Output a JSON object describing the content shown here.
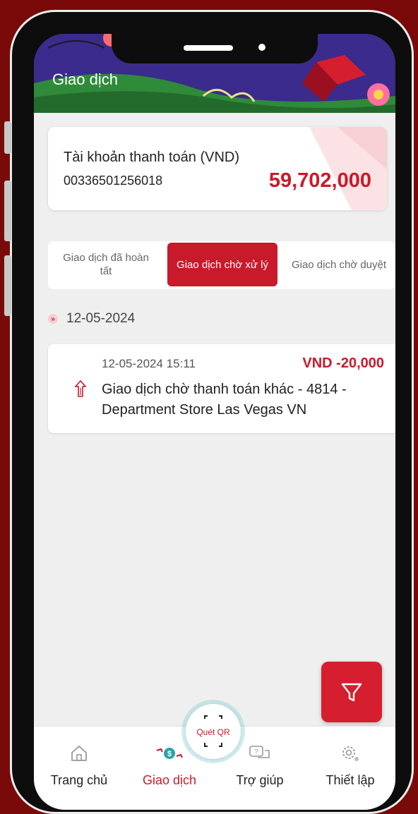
{
  "header": {
    "title": "Giao dịch"
  },
  "account": {
    "label": "Tài khoản thanh toán (VND)",
    "number": "00336501256018",
    "balance": "59,702,000"
  },
  "tabs": [
    {
      "label": "Giao dịch đã hoàn tất",
      "active": false
    },
    {
      "label": "Giao dịch chờ xử lý",
      "active": true
    },
    {
      "label": "Giao dịch chờ duyệt",
      "active": false
    }
  ],
  "date_group": {
    "date": "12-05-2024"
  },
  "transaction": {
    "time": "12-05-2024 15:11",
    "amount": "VND -20,000",
    "description": "Giao dịch chờ thanh toán khác - 4814 - Department Store Las Vegas VN",
    "icon": "arrow-up-icon"
  },
  "qr": {
    "label": "Quét QR"
  },
  "nav": [
    {
      "label": "Trang chủ",
      "icon": "home-icon"
    },
    {
      "label": "Giao dịch",
      "icon": "transaction-icon"
    },
    {
      "label": "Trợ giúp",
      "icon": "help-chat-icon"
    },
    {
      "label": "Thiết lập",
      "icon": "gear-icon"
    }
  ],
  "colors": {
    "accent": "#c81a2b",
    "background": "#7a0a0a",
    "header": "#3a2b8c"
  }
}
